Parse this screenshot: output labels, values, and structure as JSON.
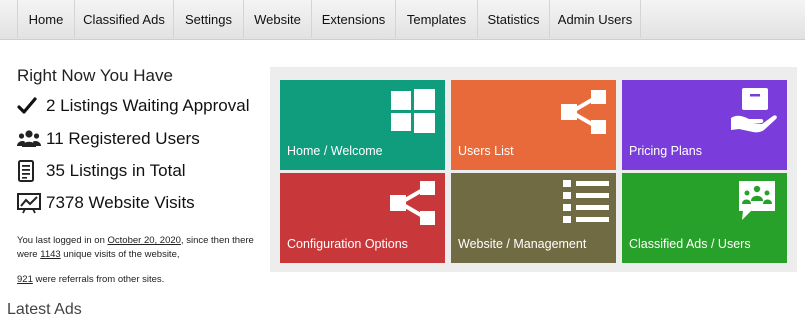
{
  "nav": {
    "items": [
      "Home",
      "Classified Ads",
      "Settings",
      "Website",
      "Extensions",
      "Templates",
      "Statistics",
      "Admin Users"
    ]
  },
  "summary": {
    "title": "Right Now You Have",
    "stats": [
      {
        "icon": "check-icon",
        "text": "2 Listings Waiting Approval"
      },
      {
        "icon": "users-icon",
        "text": "11 Registered Users"
      },
      {
        "icon": "document-icon",
        "text": "35 Listings in Total"
      },
      {
        "icon": "chart-icon",
        "text": "7378 Website Visits"
      }
    ],
    "login": {
      "prefix": "You last logged in on ",
      "date": "October 20, 2020",
      "middle": ", since then there were ",
      "visits": "1143",
      "suffix": " unique visits of the website,",
      "referrals": "921",
      "referrals_suffix": " were referrals from other sites."
    }
  },
  "tiles": [
    {
      "label": "Home / Welcome",
      "icon": "windows-icon",
      "color": "#0f9d7d"
    },
    {
      "label": "Users List",
      "icon": "share-icon",
      "color": "#e8693a"
    },
    {
      "label": "Pricing Plans",
      "icon": "package-hand-icon",
      "color": "#7a3ddc"
    },
    {
      "label": "Configuration Options",
      "icon": "share-icon",
      "color": "#c8373a"
    },
    {
      "label": "Website / Management",
      "icon": "list-icon",
      "color": "#716b44"
    },
    {
      "label": "Classified Ads / Users",
      "icon": "chat-users-icon",
      "color": "#27a12a"
    }
  ],
  "latest_title": "Latest Ads"
}
